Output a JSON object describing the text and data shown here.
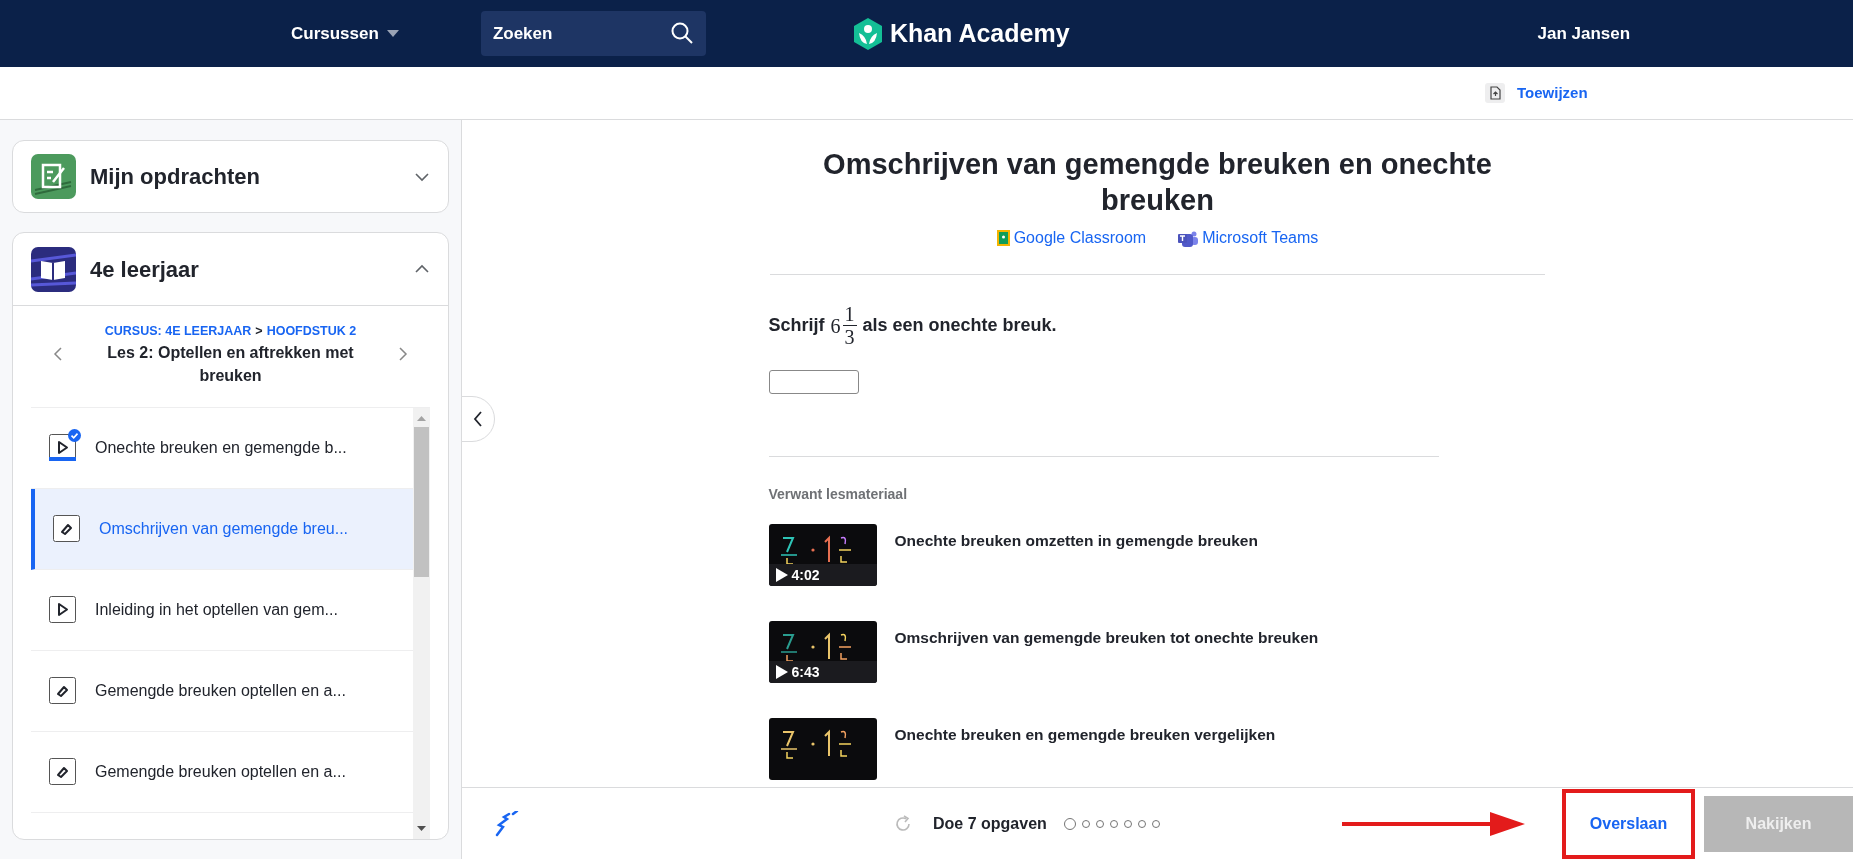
{
  "header": {
    "courses_menu": "Cursussen",
    "search": {
      "placeholder": "Zoeken"
    },
    "logo": "Khan Academy",
    "user": "Jan Jansen"
  },
  "toolbar": {
    "assign": "Toewijzen"
  },
  "sidebar": {
    "assignments": {
      "title": "Mijn opdrachten",
      "expanded": false
    },
    "course": {
      "title": "4e leerjaar",
      "expanded": true,
      "breadcrumb": {
        "course": "CURSUS: 4E LEERJAAR",
        "separator": ">",
        "unit": "HOOFDSTUK 2"
      },
      "lesson": "Les 2: Optellen en aftrekken met breuken",
      "items": [
        {
          "kind": "video",
          "title": "Onechte breuken en gemengde b...",
          "completed": true,
          "selected": false
        },
        {
          "kind": "exercise",
          "title": "Omschrijven van gemengde breu...",
          "completed": false,
          "selected": true
        },
        {
          "kind": "video",
          "title": "Inleiding in het optellen van gem...",
          "completed": false,
          "selected": false
        },
        {
          "kind": "exercise",
          "title": "Gemengde breuken optellen en a...",
          "completed": false,
          "selected": false
        },
        {
          "kind": "exercise",
          "title": "Gemengde breuken optellen en a...",
          "completed": false,
          "selected": false
        }
      ]
    }
  },
  "exercise": {
    "title": "Omschrijven van gemengde breuken en onechte breuken",
    "share_links": [
      {
        "kind": "classroom",
        "label": "Google Classroom"
      },
      {
        "kind": "teams",
        "label": "Microsoft Teams"
      }
    ],
    "question": {
      "before": "Schrijf",
      "whole": "6",
      "numerator": "1",
      "denominator": "3",
      "after": "als een onechte breuk."
    },
    "related": {
      "heading": "Verwant lesmateriaal",
      "videos": [
        {
          "title": "Onechte breuken omzetten in gemengde breuken",
          "duration": "4:02"
        },
        {
          "title": "Omschrijven van gemengde breuken tot onechte breuken",
          "duration": "6:43"
        },
        {
          "title": "Onechte breuken en gemengde breuken vergelijken"
        }
      ]
    }
  },
  "footer": {
    "task": "Doe 7 opgaven",
    "dots": [
      {
        "current": true
      },
      {
        "current": false
      },
      {
        "current": false
      },
      {
        "current": false
      },
      {
        "current": false
      },
      {
        "current": false
      },
      {
        "current": false
      }
    ],
    "skip": "Overslaan",
    "check": {
      "label": "Nakijken",
      "disabled": true
    }
  }
}
